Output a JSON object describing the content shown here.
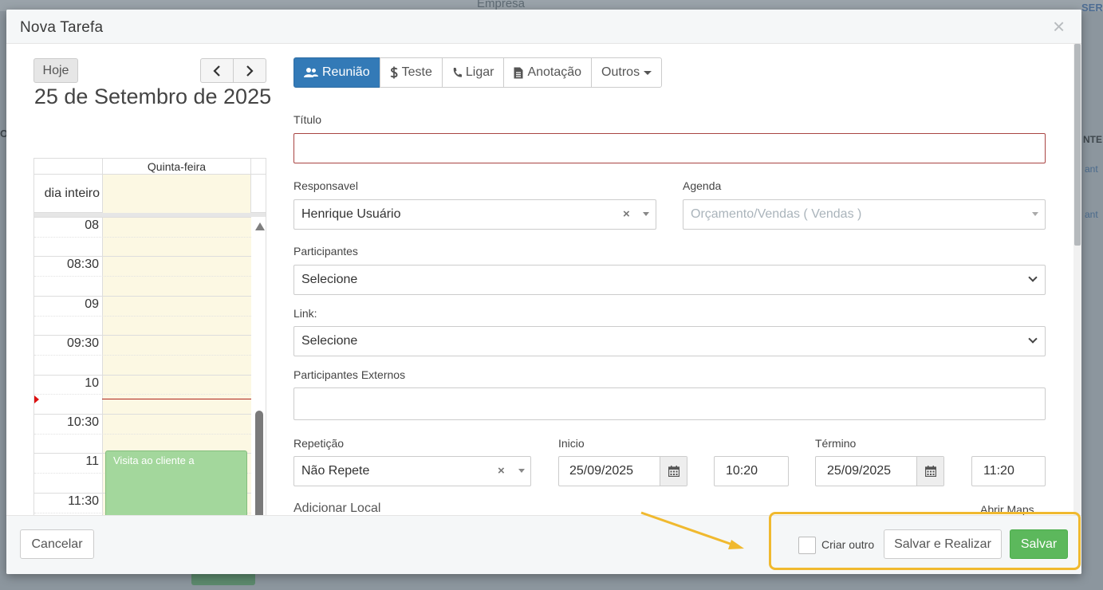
{
  "background": {
    "empresa_label": "Empresa",
    "top_right_text": "SER",
    "left_fragment": "O",
    "right_header_fragment": "NTE",
    "right_row1_fragment": "ant",
    "right_row2_fragment": "ant"
  },
  "modal": {
    "title": "Nova Tarefa",
    "close_glyph": "×"
  },
  "calendar": {
    "today_label": "Hoje",
    "prev_glyph": "‹",
    "next_glyph": "›",
    "date_title": "25 de Setembro de 2025",
    "day_header": "Quinta-feira",
    "all_day_label": "dia inteiro",
    "time_labels": [
      "08",
      "08:30",
      "09",
      "09:30",
      "10",
      "10:30",
      "11",
      "11:30"
    ],
    "event_title": "Visita ao cliente a"
  },
  "task_types": [
    {
      "label": "Reunião",
      "icon": "users-icon",
      "active": true
    },
    {
      "label": "Teste",
      "icon": "dollar-icon",
      "active": false
    },
    {
      "label": "Ligar",
      "icon": "phone-icon",
      "active": false
    },
    {
      "label": "Anotação",
      "icon": "file-icon",
      "active": false
    },
    {
      "label": "Outros",
      "icon": "caret-down-icon",
      "active": false
    }
  ],
  "form": {
    "titulo_label": "Título",
    "titulo_value": "",
    "responsavel_label": "Responsavel",
    "responsavel_value": "Henrique Usuário",
    "agenda_label": "Agenda",
    "agenda_value": "Orçamento/Vendas ( Vendas )",
    "participantes_label": "Participantes",
    "participantes_value": "Selecione",
    "link_label": "Link:",
    "link_value": "Selecione",
    "externos_label": "Participantes Externos",
    "externos_value": "",
    "repeticao_label": "Repetição",
    "repeticao_value": "Não Repete",
    "inicio_label": "Inicio",
    "inicio_date": "25/09/2025",
    "inicio_time": "10:20",
    "termino_label": "Término",
    "termino_date": "25/09/2025",
    "termino_time": "11:20",
    "local_label": "Adicionar Local",
    "maps_label": "Abrir Maps"
  },
  "footer": {
    "cancel_label": "Cancelar",
    "criar_outro_label": "Criar outro",
    "criar_outro_checked": false,
    "save_realize_label": "Salvar e Realizar",
    "save_label": "Salvar"
  },
  "colors": {
    "primary": "#337ab7",
    "success": "#5cb85c",
    "highlight": "#f0b92f",
    "event": "#a3d79c",
    "today_bg": "#fcf8e3",
    "now_line": "#b0241a"
  }
}
